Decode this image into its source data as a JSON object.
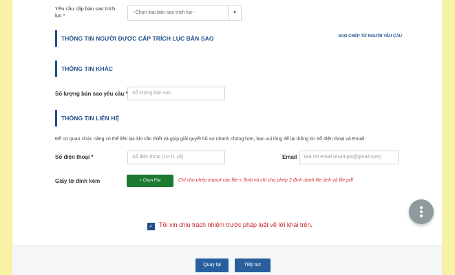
{
  "form": {
    "copy_type_label": "Yêu cầu cấp bản sao trích lục *",
    "copy_type_selected": "--Chọn loại bản sao trích lục--",
    "section_recipient": "THÔNG TIN NGƯỜI ĐƯỢC CẤP TRÍCH LỤC BẢN SAO",
    "copy_from_requester_link": "SAO CHÉP TỪ NGƯỜI YÊU CẦU",
    "section_other": "THÔNG TIN KHÁC",
    "quantity_label": "Số lượng bản sao yêu cầu *",
    "quantity_placeholder": "Số lượng bản sao",
    "section_contact": "THÔNG TIN LIÊN HỆ",
    "contact_info": "Để cơ quan chức năng có thể liên lạc khi cần thiết và giúp giải quyết hồ sơ nhanh chóng hơn, bạn vui lòng để lại thông tin Số điện thoại và Email",
    "phone_label": "Số điện thoại *",
    "phone_placeholder": "Số điện thoại (10-11 số)",
    "email_label": "Email",
    "email_placeholder": "Địa chỉ email (example@gmail.com)",
    "attachment_label": "Giấy tờ đính kèm",
    "choose_file_button": "+ Chọn File",
    "attachment_note": "Chỉ cho phép import các file < 3mb và chỉ cho phép 2 định danh file ảnh và file pdf",
    "commitment_text": "Tôi xin chịu trách nhiệm trước pháp luật về lời khai trên."
  },
  "actions": {
    "back_label": "Quay lại",
    "next_label": "Tiếp tục"
  },
  "colors": {
    "accent": "#1f4f8a",
    "file_button": "#1d7a33",
    "warning": "#d32f2f",
    "background": "#f7f2a6"
  },
  "icons": {
    "fab": "more-vertical-icon",
    "checkbox": "checkmark-icon"
  }
}
